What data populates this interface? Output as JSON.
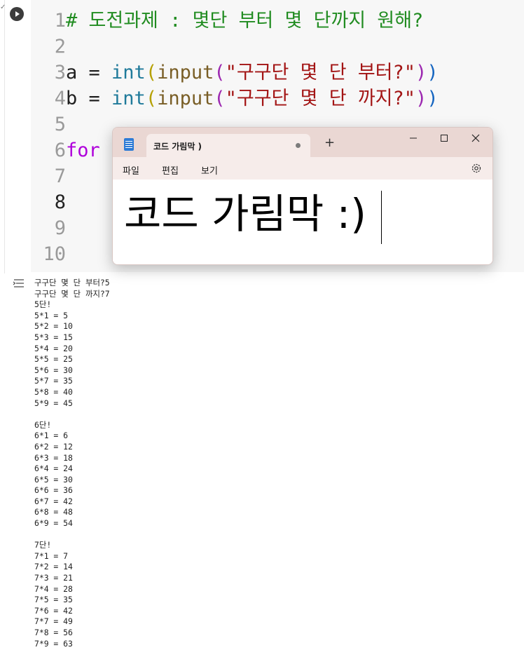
{
  "cell": {
    "edit_mark": "✓",
    "lines": [
      {
        "n": "1",
        "tokens": [
          {
            "t": "# 도전과제 : 몇단 부터 몇 단까지 원해?",
            "c": "comment"
          }
        ]
      },
      {
        "n": "2",
        "tokens": []
      },
      {
        "n": "3",
        "tokens": [
          {
            "t": "a = ",
            "c": "plain"
          },
          {
            "t": "int",
            "c": "builtin"
          },
          {
            "t": "(",
            "c": "paren1"
          },
          {
            "t": "input",
            "c": "func"
          },
          {
            "t": "(",
            "c": "paren2"
          },
          {
            "t": "\"구구단 몇 단 부터?\"",
            "c": "str"
          },
          {
            "t": ")",
            "c": "paren2"
          },
          {
            "t": ")",
            "c": "paren3"
          }
        ]
      },
      {
        "n": "4",
        "tokens": [
          {
            "t": "b = ",
            "c": "plain"
          },
          {
            "t": "int",
            "c": "builtin"
          },
          {
            "t": "(",
            "c": "paren1"
          },
          {
            "t": "input",
            "c": "func"
          },
          {
            "t": "(",
            "c": "paren2"
          },
          {
            "t": "\"구구단 몇 단 까지?\"",
            "c": "str"
          },
          {
            "t": ")",
            "c": "paren2"
          },
          {
            "t": ")",
            "c": "paren3"
          }
        ]
      },
      {
        "n": "5",
        "tokens": []
      },
      {
        "n": "6",
        "tokens": [
          {
            "t": "for",
            "c": "kw"
          }
        ]
      },
      {
        "n": "7",
        "tokens": []
      },
      {
        "n": "8",
        "tokens": [],
        "active": true
      },
      {
        "n": "9",
        "tokens": []
      },
      {
        "n": "10",
        "tokens": []
      }
    ]
  },
  "notepad": {
    "tab_title": "코드 가림막 )",
    "new_tab": "+",
    "menus": [
      "파일",
      "편집",
      "보기"
    ],
    "content": "코드 가림막 :)"
  },
  "output_lines": [
    "구구단 몇 단 부터?5",
    "구구단 몇 단 까지?7",
    "5단!",
    "5*1 = 5",
    "5*2 = 10",
    "5*3 = 15",
    "5*4 = 20",
    "5*5 = 25",
    "5*6 = 30",
    "5*7 = 35",
    "5*8 = 40",
    "5*9 = 45",
    "",
    "6단!",
    "6*1 = 6",
    "6*2 = 12",
    "6*3 = 18",
    "6*4 = 24",
    "6*5 = 30",
    "6*6 = 36",
    "6*7 = 42",
    "6*8 = 48",
    "6*9 = 54",
    "",
    "7단!",
    "7*1 = 7",
    "7*2 = 14",
    "7*3 = 21",
    "7*4 = 28",
    "7*5 = 35",
    "7*6 = 42",
    "7*7 = 49",
    "7*8 = 56",
    "7*9 = 63"
  ],
  "icons": {
    "run": "play-circle-icon",
    "output": "output-menu-icon",
    "settings": "gear-icon",
    "notepad_app": "notepad-icon"
  }
}
